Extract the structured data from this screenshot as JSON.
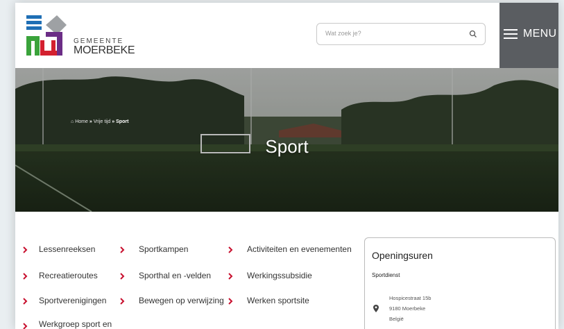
{
  "header": {
    "logo_line1": "GEMEENTE",
    "logo_line2": "MOERBEKE",
    "search_placeholder": "Wat zoek je?",
    "menu_label": "MENU"
  },
  "hero": {
    "breadcrumb": {
      "home": "Home",
      "level2": "Vrije tijd",
      "current": "Sport",
      "separator": "»"
    },
    "title": "Sport"
  },
  "links": {
    "col1": [
      "Lessenreeksen",
      "Recreatieroutes",
      "Sportverenigingen",
      "Werkgroep sport en"
    ],
    "col2": [
      "Sportkampen",
      "Sporthal en -velden",
      "Bewegen op verwijzing"
    ],
    "col3": [
      "Activiteiten en evenementen",
      "Werkingssubsidie",
      "Werken sportsite"
    ]
  },
  "opening": {
    "title": "Openingsuren",
    "service": "Sportdienst",
    "address": [
      "Hospicestraat 15b",
      "9180 Moerbeke",
      "België"
    ]
  },
  "colors": {
    "accent": "#c8102e",
    "menu_bg": "#5a5d61",
    "logo_blue": "#1f6fb5",
    "logo_green": "#3aa33b",
    "logo_red": "#d3202f",
    "logo_purple": "#6b2d86"
  },
  "icons": [
    "logo",
    "search-icon",
    "hamburger-icon",
    "home-icon",
    "chevron-right-icon",
    "location-pin-icon"
  ]
}
